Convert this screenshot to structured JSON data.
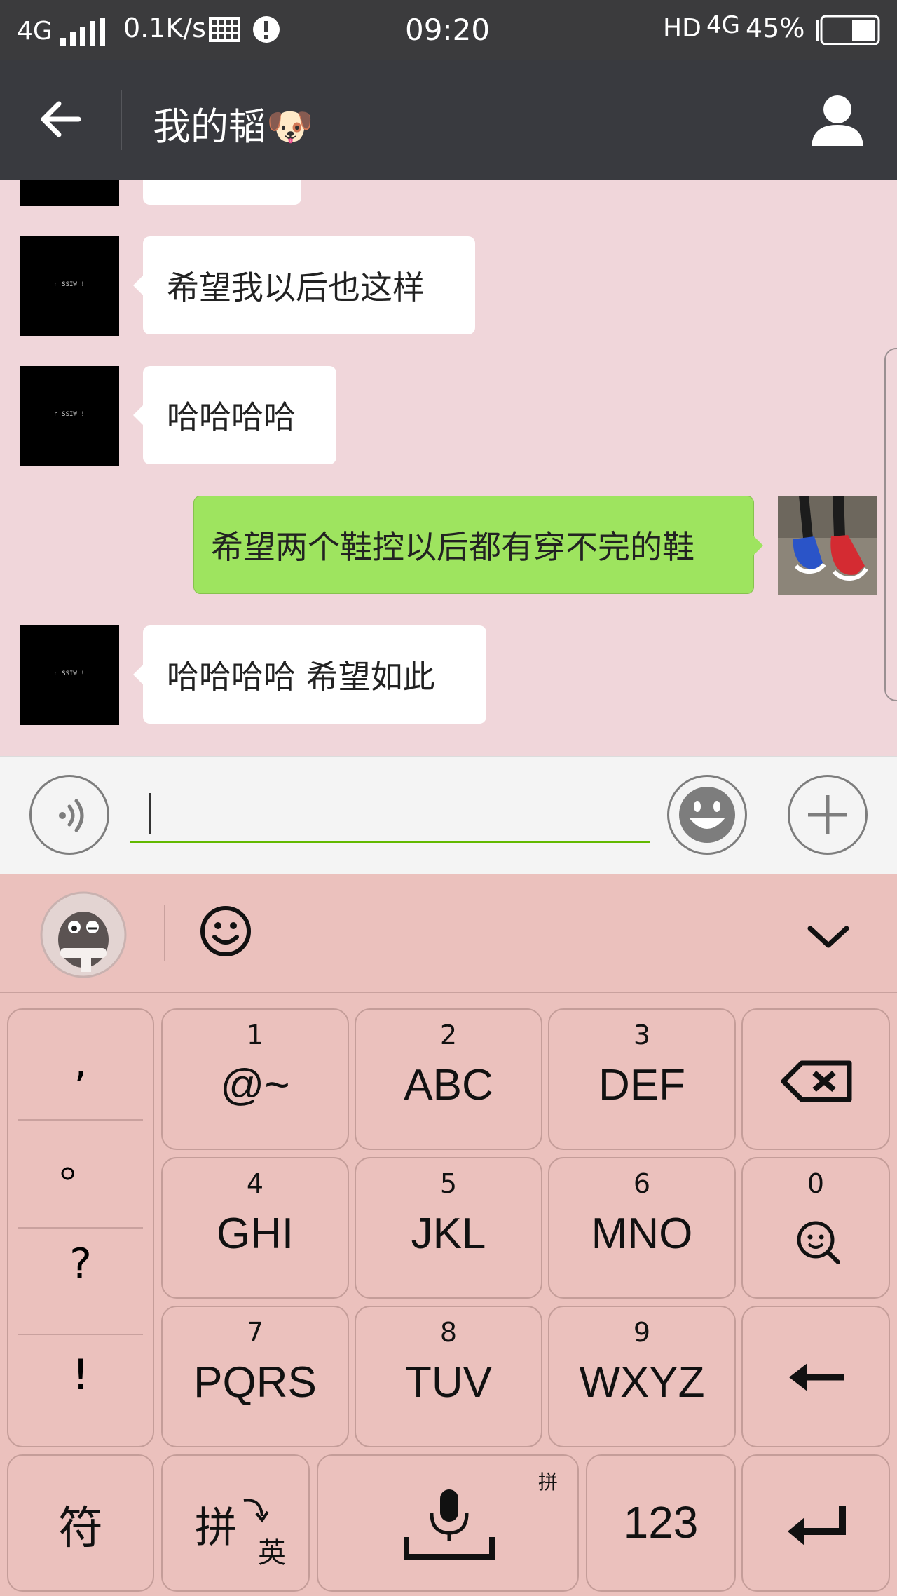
{
  "status_bar": {
    "network": "4G",
    "speed": "0.1K/s",
    "time": "09:20",
    "hd": "HD",
    "network_right": "4G",
    "battery": "45%"
  },
  "header": {
    "title": "我的韬🐶"
  },
  "messages": [
    {
      "side": "left",
      "text": "希望我以后也这样"
    },
    {
      "side": "left",
      "text": "哈哈哈哈"
    },
    {
      "side": "right",
      "text": "希望两个鞋控以后都有穿不完的鞋"
    },
    {
      "side": "left",
      "text": "哈哈哈哈 希望如此"
    }
  ],
  "avatar_text": "n SSIW !",
  "keyboard": {
    "symbols": [
      ",",
      "。",
      "?",
      "!"
    ],
    "keys": [
      {
        "num": "1",
        "label": "@~"
      },
      {
        "num": "2",
        "label": "ABC"
      },
      {
        "num": "3",
        "label": "DEF"
      },
      {
        "num": "4",
        "label": "GHI"
      },
      {
        "num": "5",
        "label": "JKL"
      },
      {
        "num": "6",
        "label": "MNO"
      },
      {
        "num": "0",
        "label": "☺"
      },
      {
        "num": "7",
        "label": "PQRS"
      },
      {
        "num": "8",
        "label": "TUV"
      },
      {
        "num": "9",
        "label": "WXYZ"
      }
    ],
    "bottom": {
      "fu": "符",
      "pin": "拼",
      "ying": "英",
      "space_tag": "拼",
      "num123": "123"
    }
  },
  "colors": {
    "header_bg": "#393a3f",
    "chat_bg": "#f0d6da",
    "outgoing_bubble": "#9ee45f",
    "input_underline": "#62b900",
    "keyboard_bg": "#ebc1bd"
  }
}
